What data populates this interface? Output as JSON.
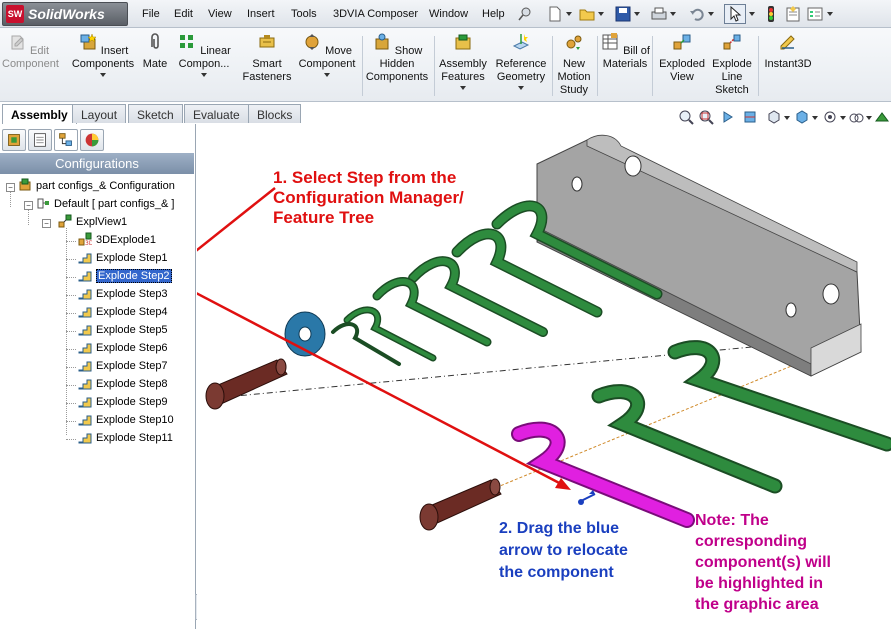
{
  "app": {
    "name": "SolidWorks",
    "logo_mark": "SW"
  },
  "menu": [
    "File",
    "Edit",
    "View",
    "Insert",
    "Tools",
    "3DVIA Composer",
    "Window",
    "Help"
  ],
  "command_manager": [
    {
      "label": "Edit Component",
      "enabled": false
    },
    {
      "label": "Insert Components",
      "dropdown": true
    },
    {
      "label": "Mate"
    },
    {
      "label": "Linear Compon...",
      "dropdown": true
    },
    {
      "label": "Smart Fasteners"
    },
    {
      "label": "Move Component",
      "dropdown": true
    },
    {
      "label": "Show Hidden Components"
    },
    {
      "label": "Assembly Features",
      "dropdown": true
    },
    {
      "label": "Reference Geometry",
      "dropdown": true
    },
    {
      "label": "New Motion Study"
    },
    {
      "label": "Bill of Materials"
    },
    {
      "label": "Exploded View"
    },
    {
      "label": "Explode Line Sketch"
    },
    {
      "label": "Instant3D"
    }
  ],
  "tabs": [
    {
      "label": "Assembly",
      "active": true
    },
    {
      "label": "Layout"
    },
    {
      "label": "Sketch"
    },
    {
      "label": "Evaluate"
    },
    {
      "label": "Blocks"
    }
  ],
  "panel": {
    "header": "Configurations",
    "tree": {
      "root": "part configs_& Configuration",
      "config": "Default [ part configs_& ]",
      "explview": "ExplView1",
      "items": [
        "3DExplode1",
        "Explode Step1",
        "Explode Step2",
        "Explode Step3",
        "Explode Step4",
        "Explode Step5",
        "Explode Step6",
        "Explode Step7",
        "Explode Step8",
        "Explode Step9",
        "Explode Step10",
        "Explode Step11"
      ],
      "selected_item": "Explode Step2"
    }
  },
  "annotations": {
    "step1": [
      "1. Select Step from the",
      "Configuration Manager/",
      "Feature Tree"
    ],
    "step2": [
      "2. Drag the blue",
      "arrow to relocate",
      "the component"
    ],
    "note": [
      "Note: The",
      "corresponding",
      "component(s) will",
      "be highlighted in",
      "the graphic area"
    ]
  },
  "colors": {
    "annotation_red": "#e01010",
    "annotation_blue": "#1a3fbf",
    "annotation_magenta": "#c0008a",
    "selection": "#3366cc",
    "spring_green": "#2d7a3a",
    "highlight_magenta": "#e020e0",
    "bracket_gray": "#9a9a9a",
    "washer_blue": "#2a78a8",
    "pin_brown": "#6b2b24"
  }
}
